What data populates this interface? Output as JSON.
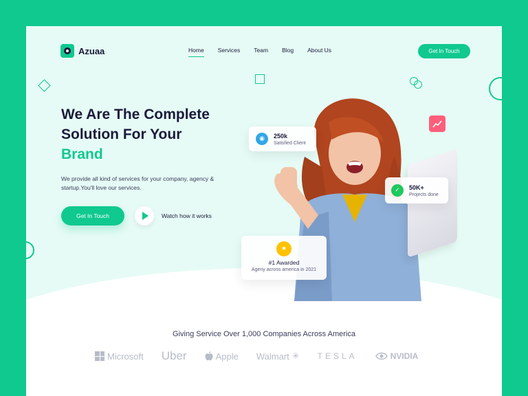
{
  "colors": {
    "accent": "#10c98f",
    "dark": "#1a1a3a",
    "hero_bg": "#e6fbf5",
    "gray_logo": "#b7bcc8",
    "badge_pink": "#ff5f7a"
  },
  "logo": {
    "name": "Azuaa"
  },
  "nav": {
    "items": [
      "Home",
      "Services",
      "Team",
      "Blog",
      "About Us"
    ],
    "active": "Home"
  },
  "header": {
    "cta_label": "Get In Touch"
  },
  "hero": {
    "title_line1": "We Are The Complete",
    "title_line2": "Solution For Your",
    "title_line3": "Brand",
    "description": "We provide all kind of services for your company, agency & startup.You'll love our services.",
    "cta_label": "Get In Touch",
    "watch_label": "Watch how it works"
  },
  "stats": {
    "clients": {
      "value": "250k",
      "label": "Satisfied Client"
    },
    "projects": {
      "value": "50K+",
      "label": "Projects done"
    },
    "award": {
      "value": "#1 Awarded",
      "label": "Ageny across america in 2021"
    }
  },
  "companies": {
    "title": "Giving Service Over 1,000 Companies  Across America",
    "logos": [
      "Microsoft",
      "Uber",
      "Apple",
      "Walmart",
      "TESLA",
      "NVIDIA"
    ]
  }
}
